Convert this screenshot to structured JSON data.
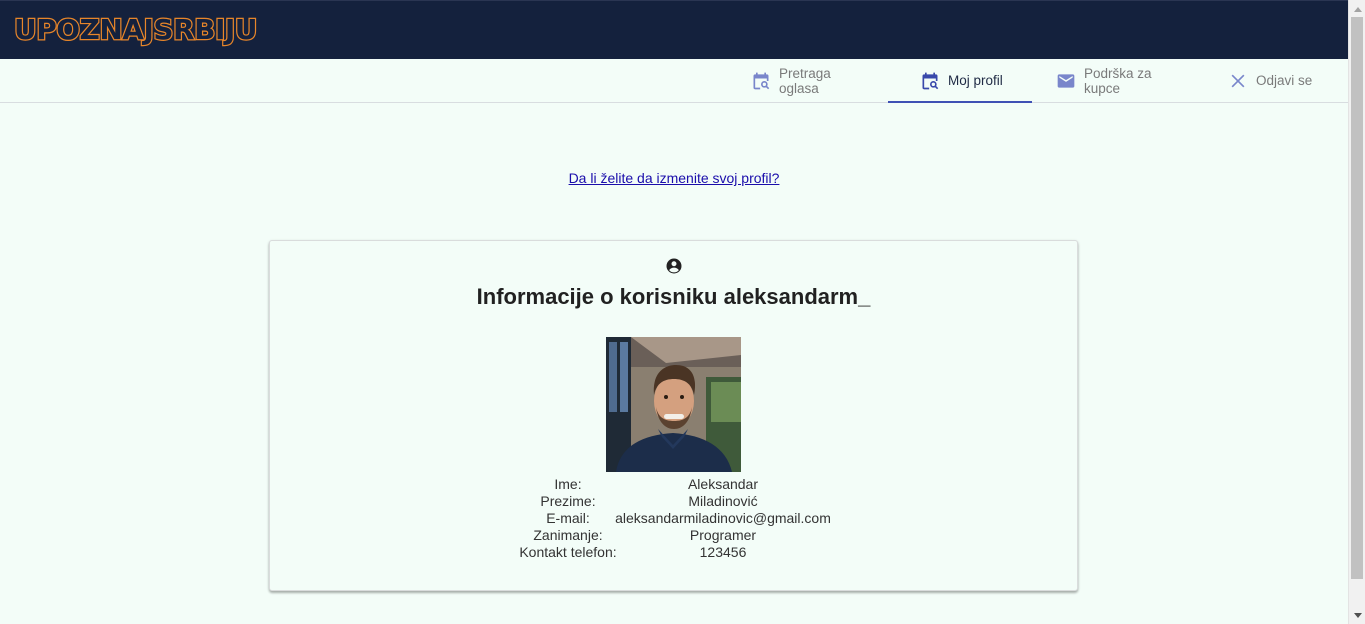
{
  "brand": {
    "logo_text": "UPOZNAJSRBIJU",
    "logo_color": "#e8862a",
    "header_bg": "#14213d"
  },
  "tabs": [
    {
      "label": "Pretraga oglasa",
      "icon": "calendar-search-icon",
      "active": false
    },
    {
      "label": "Moj profil",
      "icon": "calendar-search-icon",
      "active": true
    },
    {
      "label": "Podrška za kupce",
      "icon": "mail-icon",
      "active": false
    },
    {
      "label": "Odjavi se",
      "icon": "close-icon",
      "active": false
    }
  ],
  "edit_profile_link": "Da li želite da izmenite svoj profil?",
  "card": {
    "icon": "account-circle-icon",
    "title": "Informacije o korisniku aleksandarm_",
    "fields": [
      {
        "label": "Ime:",
        "value": "Aleksandar"
      },
      {
        "label": "Prezime:",
        "value": "Miladinović"
      },
      {
        "label": "E-mail:",
        "value": "aleksandarmiladinovic@gmail.com"
      },
      {
        "label": "Zanimanje:",
        "value": "Programer"
      },
      {
        "label": "Kontakt telefon:",
        "value": "123456"
      }
    ]
  },
  "colors": {
    "accent": "#3f51b5",
    "page_bg": "#f3fdf8",
    "link": "#1a0dab"
  }
}
